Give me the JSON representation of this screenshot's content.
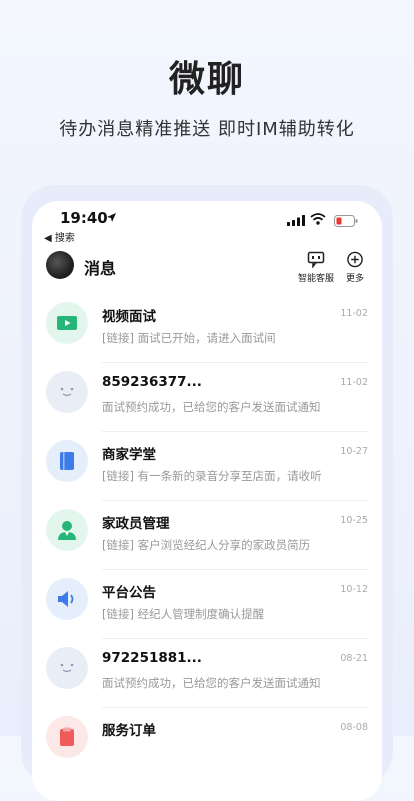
{
  "hero": {
    "title": "微聊",
    "subtitle": "待办消息精准推送  即时IM辅助转化"
  },
  "status_bar": {
    "time": "19:40",
    "back_label": "◀ 搜索"
  },
  "header": {
    "title": "消息",
    "service_label": "智能客服",
    "more_label": "更多"
  },
  "messages": [
    {
      "name": "视频面试",
      "preview": "[链接] 面试已开始，请进入面试间",
      "date": "11-02",
      "icon": "video-icon"
    },
    {
      "name": "859236377...",
      "preview": "面试预约成功，已给您的客户发送面试通知",
      "date": "11-02",
      "icon": "smiley-avatar-icon"
    },
    {
      "name": "商家学堂",
      "preview": "[链接] 有一条新的录音分享至店面，请收听",
      "date": "10-27",
      "icon": "book-icon"
    },
    {
      "name": "家政员管理",
      "preview": "[链接] 客户浏览经纪人分享的家政员简历",
      "date": "10-25",
      "icon": "person-icon"
    },
    {
      "name": "平台公告",
      "preview": "[链接] 经纪人管理制度确认提醒",
      "date": "10-12",
      "icon": "speaker-icon"
    },
    {
      "name": "972251881...",
      "preview": "面试预约成功，已给您的客户发送面试通知",
      "date": "08-21",
      "icon": "smiley-avatar-icon"
    },
    {
      "name": "服务订单",
      "preview": "",
      "date": "08-08",
      "icon": "order-icon"
    }
  ]
}
